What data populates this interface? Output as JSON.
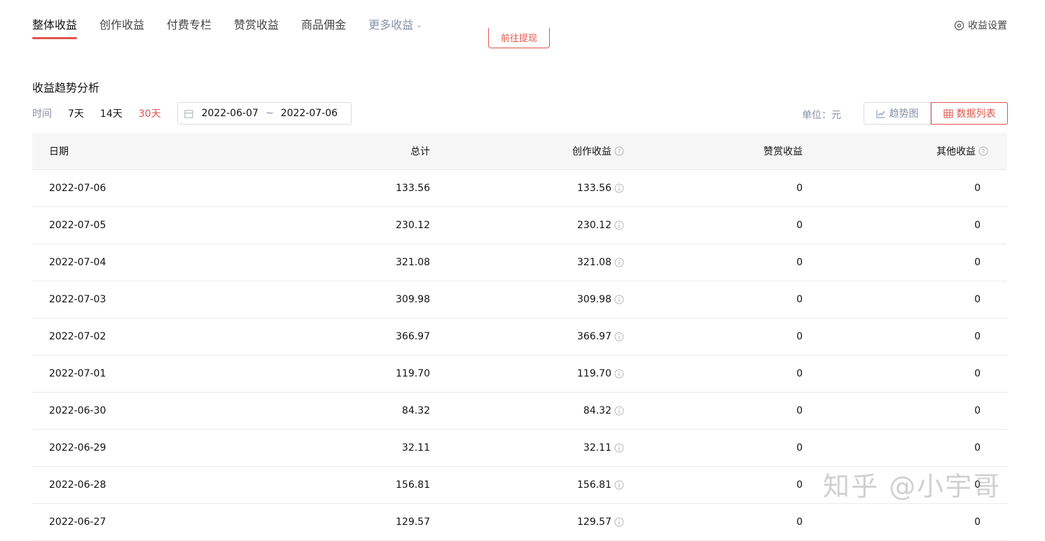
{
  "tabs": [
    {
      "label": "整体收益"
    },
    {
      "label": "创作收益"
    },
    {
      "label": "付费专栏"
    },
    {
      "label": "赞赏收益"
    },
    {
      "label": "商品佣金"
    },
    {
      "label": "更多收益"
    }
  ],
  "settings": {
    "label": "收益设置"
  },
  "cashout": {
    "label": "前往提现"
  },
  "trend": {
    "title": "收益趋势分析",
    "time_label": "时间",
    "ranges": [
      "7天",
      "14天",
      "30天"
    ],
    "date_start": "2022-06-07",
    "date_sep": "~",
    "date_end": "2022-07-06",
    "unit": "单位：元",
    "view_chart": "趋势图",
    "view_table": "数据列表"
  },
  "table": {
    "headers": {
      "date": "日期",
      "total": "总计",
      "creation": "创作收益",
      "reward": "赞赏收益",
      "other": "其他收益"
    },
    "rows": [
      {
        "date": "2022-07-06",
        "total": "133.56",
        "creation": "133.56",
        "reward": "0",
        "other": "0"
      },
      {
        "date": "2022-07-05",
        "total": "230.12",
        "creation": "230.12",
        "reward": "0",
        "other": "0"
      },
      {
        "date": "2022-07-04",
        "total": "321.08",
        "creation": "321.08",
        "reward": "0",
        "other": "0"
      },
      {
        "date": "2022-07-03",
        "total": "309.98",
        "creation": "309.98",
        "reward": "0",
        "other": "0"
      },
      {
        "date": "2022-07-02",
        "total": "366.97",
        "creation": "366.97",
        "reward": "0",
        "other": "0"
      },
      {
        "date": "2022-07-01",
        "total": "119.70",
        "creation": "119.70",
        "reward": "0",
        "other": "0"
      },
      {
        "date": "2022-06-30",
        "total": "84.32",
        "creation": "84.32",
        "reward": "0",
        "other": "0"
      },
      {
        "date": "2022-06-29",
        "total": "32.11",
        "creation": "32.11",
        "reward": "0",
        "other": "0"
      },
      {
        "date": "2022-06-28",
        "total": "156.81",
        "creation": "156.81",
        "reward": "0",
        "other": "0"
      },
      {
        "date": "2022-06-27",
        "total": "129.57",
        "creation": "129.57",
        "reward": "0",
        "other": "0"
      }
    ]
  },
  "watermark": "知乎 @小宇哥",
  "colors": {
    "accent": "#e0554a",
    "muted": "#8590a6",
    "header_bg": "#f6f6f6"
  }
}
